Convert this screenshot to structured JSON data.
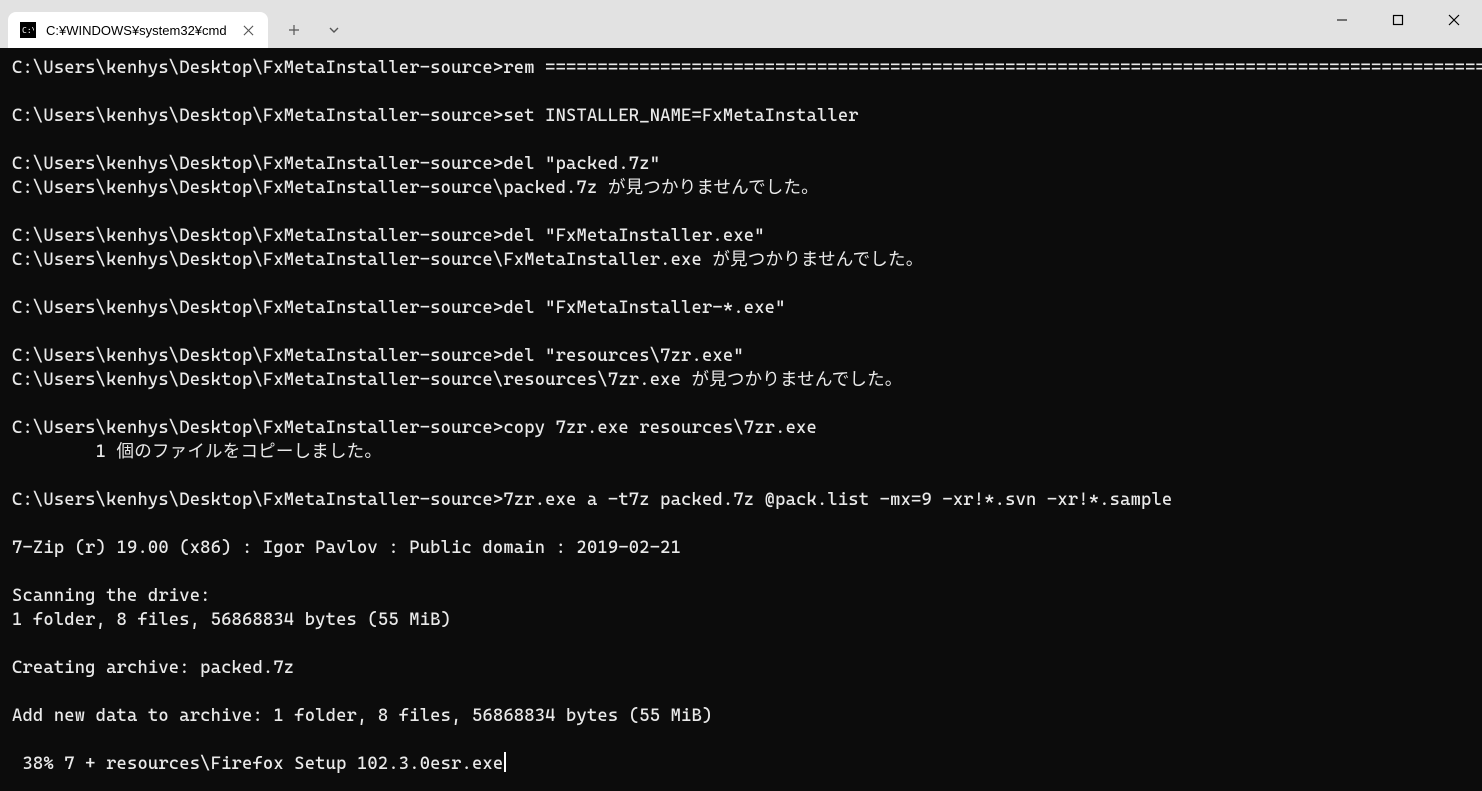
{
  "tab": {
    "title": "C:¥WINDOWS¥system32¥cmd"
  },
  "terminal": {
    "lines": [
      "C:\\Users\\kenhys\\Desktop\\FxMetaInstaller-source>rem ==========================================================================================",
      "",
      "C:\\Users\\kenhys\\Desktop\\FxMetaInstaller-source>set INSTALLER_NAME=FxMetaInstaller",
      "",
      "C:\\Users\\kenhys\\Desktop\\FxMetaInstaller-source>del \"packed.7z\"",
      "C:\\Users\\kenhys\\Desktop\\FxMetaInstaller-source\\packed.7z が見つかりませんでした。",
      "",
      "C:\\Users\\kenhys\\Desktop\\FxMetaInstaller-source>del \"FxMetaInstaller.exe\"",
      "C:\\Users\\kenhys\\Desktop\\FxMetaInstaller-source\\FxMetaInstaller.exe が見つかりませんでした。",
      "",
      "C:\\Users\\kenhys\\Desktop\\FxMetaInstaller-source>del \"FxMetaInstaller-*.exe\"",
      "",
      "C:\\Users\\kenhys\\Desktop\\FxMetaInstaller-source>del \"resources\\7zr.exe\"",
      "C:\\Users\\kenhys\\Desktop\\FxMetaInstaller-source\\resources\\7zr.exe が見つかりませんでした。",
      "",
      "C:\\Users\\kenhys\\Desktop\\FxMetaInstaller-source>copy 7zr.exe resources\\7zr.exe",
      "        1 個のファイルをコピーしました。",
      "",
      "C:\\Users\\kenhys\\Desktop\\FxMetaInstaller-source>7zr.exe a -t7z packed.7z @pack.list -mx=9 -xr!*.svn -xr!*.sample",
      "",
      "7-Zip (r) 19.00 (x86) : Igor Pavlov : Public domain : 2019-02-21",
      "",
      "Scanning the drive:",
      "1 folder, 8 files, 56868834 bytes (55 MiB)",
      "",
      "Creating archive: packed.7z",
      "",
      "Add new data to archive: 1 folder, 8 files, 56868834 bytes (55 MiB)",
      "",
      " 38% 7 + resources\\Firefox Setup 102.3.0esr.exe"
    ]
  }
}
